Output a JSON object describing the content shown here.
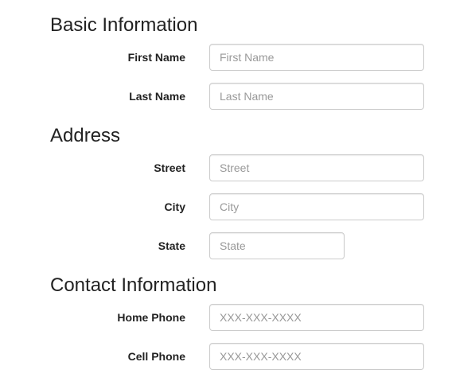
{
  "sections": {
    "basic": {
      "title": "Basic Information",
      "fields": {
        "first_name": {
          "label": "First Name",
          "placeholder": "First Name",
          "value": ""
        },
        "last_name": {
          "label": "Last Name",
          "placeholder": "Last Name",
          "value": ""
        }
      }
    },
    "address": {
      "title": "Address",
      "fields": {
        "street": {
          "label": "Street",
          "placeholder": "Street",
          "value": ""
        },
        "city": {
          "label": "City",
          "placeholder": "City",
          "value": ""
        },
        "state": {
          "label": "State",
          "placeholder": "State",
          "value": ""
        }
      }
    },
    "contact": {
      "title": "Contact Information",
      "fields": {
        "home_phone": {
          "label": "Home Phone",
          "placeholder": "XXX-XXX-XXXX",
          "value": ""
        },
        "cell_phone": {
          "label": "Cell Phone",
          "placeholder": "XXX-XXX-XXXX",
          "value": ""
        }
      }
    }
  }
}
